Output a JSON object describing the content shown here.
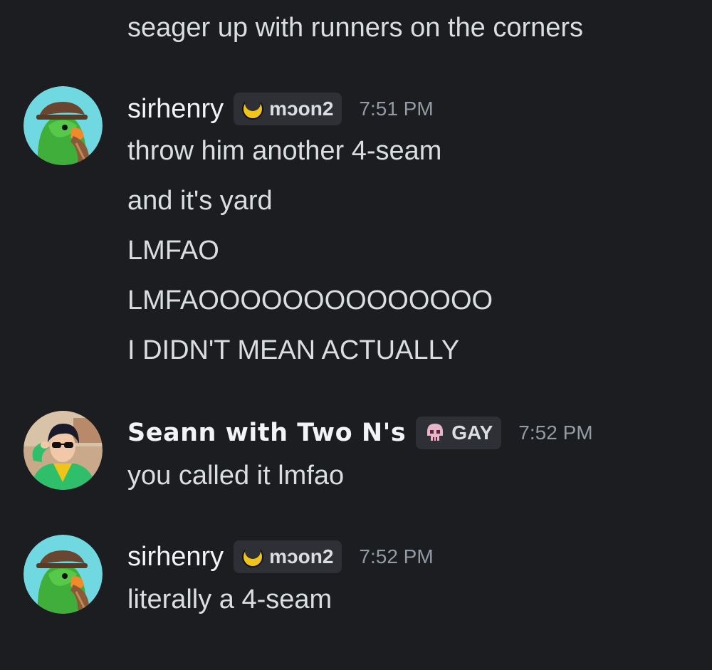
{
  "top_message": "seager up with runners on the corners",
  "groups": [
    {
      "username": "sirhenry",
      "tag": "mɔon2",
      "tag_icon": "crescent-moon-icon",
      "timestamp": "7:51 PM",
      "avatar": "green-parrot-with-fedora",
      "lines": [
        "throw him another 4-seam",
        "and it's yard",
        "LMFAO",
        "LMFAOOOOOOOOOOOOOO",
        "I DIDN'T MEAN ACTUALLY"
      ]
    },
    {
      "username": "Seann with Two N's",
      "tag": "GAY",
      "tag_icon": "pink-skull-icon",
      "timestamp": "7:52 PM",
      "avatar": "anime-character-with-sunglasses",
      "lines": [
        "you called it lmfao"
      ]
    },
    {
      "username": "sirhenry",
      "tag": "mɔon2",
      "tag_icon": "crescent-moon-icon",
      "timestamp": "7:52 PM",
      "avatar": "green-parrot-with-fedora",
      "lines": [
        "literally a 4-seam"
      ]
    }
  ],
  "colors": {
    "background": "#1c1d21",
    "text": "#dbdee1",
    "username": "#f2f3f5",
    "timestamp": "#949ba4",
    "tag_bg": "#2e3036",
    "moon": "#f0c419",
    "skull": "#e8b4c8"
  }
}
